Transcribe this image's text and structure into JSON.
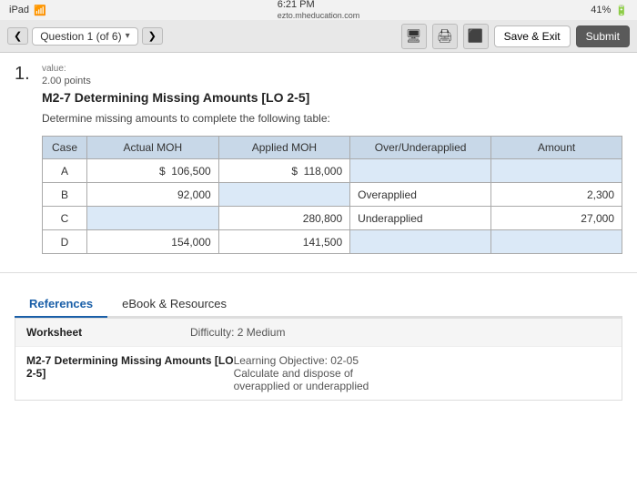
{
  "statusBar": {
    "left": "iPad",
    "wifi": "wifi",
    "time": "6:21 PM",
    "url": "ezto.mheducation.com",
    "battery": "41%"
  },
  "navBar": {
    "prevArrow": "❮",
    "questionLabel": "Question 1 (of 6)",
    "dropdownArrow": "▾",
    "nextArrow": "❯",
    "saveLabel": "Save & Exit",
    "submitLabel": "Submit"
  },
  "question": {
    "number": "1.",
    "valueMeta": "value:",
    "points": "2.00 points",
    "title": "M2-7 Determining Missing Amounts [LO 2-5]",
    "instruction": "Determine missing amounts to complete the following table:"
  },
  "table": {
    "headers": [
      "Case",
      "Actual MOH",
      "Applied MOH",
      "Over/Underapplied",
      "Amount"
    ],
    "rows": [
      {
        "case": "A",
        "actualMOH": "$ 106,500",
        "appliedMOH": "$ 118,000",
        "overUnder": "",
        "amount": "",
        "actualInput": false,
        "appliedInput": false,
        "overUnderInput": true,
        "amountInput": true
      },
      {
        "case": "B",
        "actualMOH": "92,000",
        "appliedMOH": "",
        "overUnder": "Overapplied",
        "amount": "2,300",
        "actualInput": false,
        "appliedInput": true,
        "overUnderInput": false,
        "amountInput": false
      },
      {
        "case": "C",
        "actualMOH": "",
        "appliedMOH": "280,800",
        "overUnder": "Underapplied",
        "amount": "27,000",
        "actualInput": true,
        "appliedInput": false,
        "overUnderInput": false,
        "amountInput": false
      },
      {
        "case": "D",
        "actualMOH": "154,000",
        "appliedMOH": "141,500",
        "overUnder": "",
        "amount": "",
        "actualInput": false,
        "appliedInput": false,
        "overUnderInput": true,
        "amountInput": true
      }
    ]
  },
  "tabs": [
    {
      "label": "References",
      "active": true
    },
    {
      "label": "eBook & Resources",
      "active": false
    }
  ],
  "references": [
    {
      "label": "Worksheet",
      "value": "Difficulty: 2 Medium"
    },
    {
      "label": "M2-7 Determining Missing Amounts [LO 2-5]",
      "value": "Learning Objective: 02-05 Calculate and dispose of overapplied or underapplied"
    }
  ]
}
